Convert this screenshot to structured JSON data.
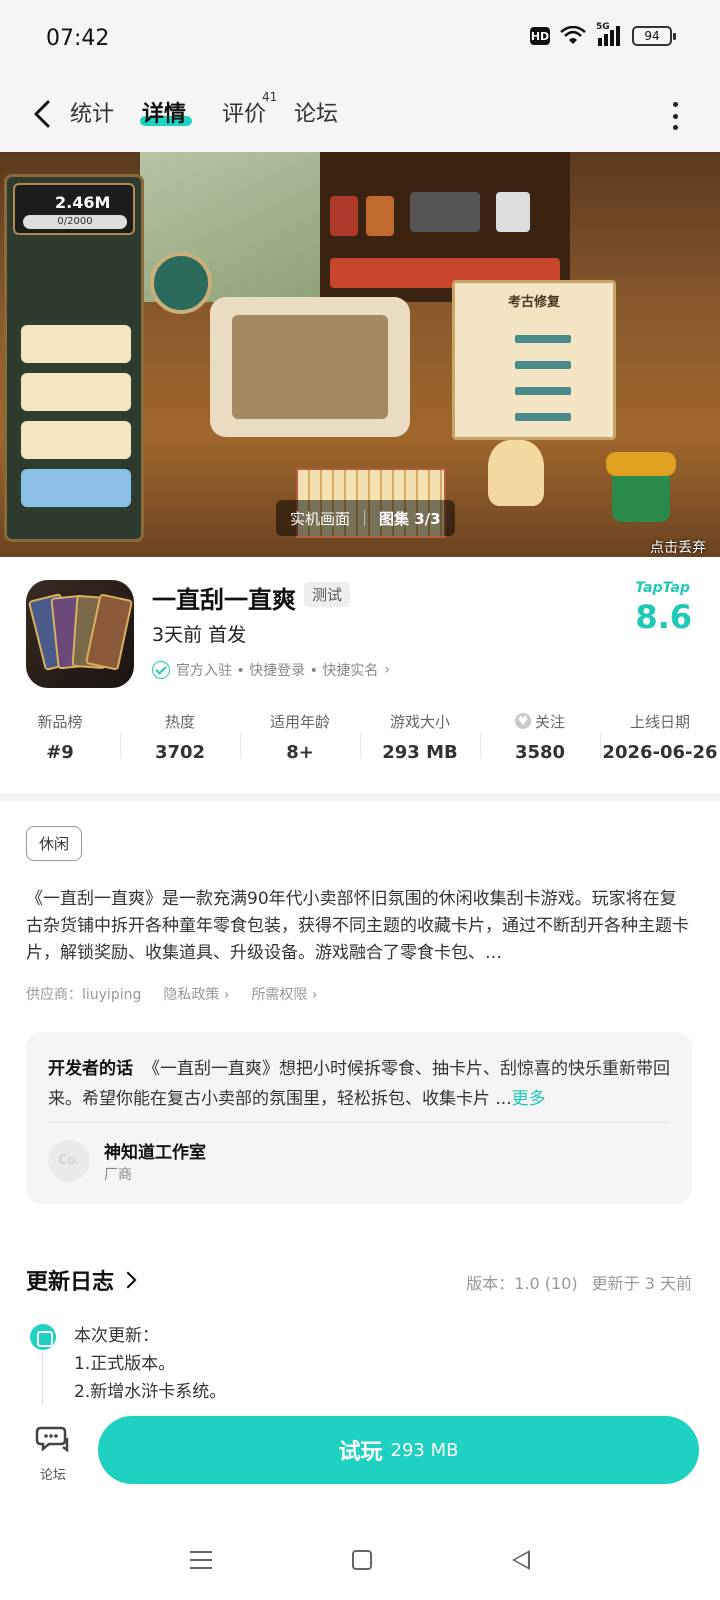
{
  "status_bar": {
    "time": "07:42",
    "hd": "HD",
    "network": "5G",
    "battery": "94"
  },
  "nav": {
    "tabs": [
      {
        "label": "统计"
      },
      {
        "label": "详情"
      },
      {
        "label": "评价"
      },
      {
        "label": "论坛"
      }
    ],
    "active_tab": "详情",
    "review_count": "41"
  },
  "banner": {
    "coins": "2.46M",
    "progress_text": "0/2000",
    "card_title": "考古修复",
    "caption_left": "实机画面",
    "caption_right": "图集 3/3",
    "discard_label": "点击丢弃"
  },
  "app": {
    "title": "一直刮一直爽",
    "badge": "测试",
    "release": "3天前 首发",
    "verified": "官方入驻 • 快捷登录 • 快捷实名",
    "rating_brand": "TapTap",
    "rating": "8.6"
  },
  "stats": [
    {
      "label": "新品榜",
      "value": "#9"
    },
    {
      "label": "热度",
      "value": "3702"
    },
    {
      "label": "适用年龄",
      "value": "8+"
    },
    {
      "label": "游戏大小",
      "value": "293 MB"
    },
    {
      "label": "关注",
      "value": "3580"
    },
    {
      "label": "上线日期",
      "value": "2026-06-26"
    }
  ],
  "tag": "休闲",
  "description": "《一直刮一直爽》是一款充满90年代小卖部怀旧氛围的休闲收集刮卡游戏。玩家将在复古杂货铺中拆开各种童年零食包装，获得不同主题的收藏卡片，通过不断刮开各种主题卡片，解锁奖励、收集道具、升级设备。游戏融合了零食卡包、…",
  "meta": {
    "provider": "供应商：liuyiping",
    "privacy": "隐私政策 ›",
    "permissions": "所需权限 ›"
  },
  "developer": {
    "heading": "开发者的话",
    "text": "《一直刮一直爽》想把小时候拆零食、抽卡片、刮惊喜的快乐重新带回来。希望你能在复古小卖部的氛围里，轻松拆包、收集卡片 ...",
    "more": "更多",
    "avatar": "Co.",
    "name": "神知道工作室",
    "role": "厂商"
  },
  "changelog": {
    "title": "更新日志",
    "version": "版本：1.0 (10)",
    "updated": "更新于 3 天前",
    "lines": [
      "本次更新：",
      "1.正式版本。",
      "2.新增水浒卡系统。"
    ]
  },
  "bottom": {
    "forum_label": "论坛",
    "try_label": "试玩",
    "try_size": "293 MB"
  },
  "colors": {
    "accent": "#1fd1c1",
    "rating": "#1fc9b8"
  }
}
